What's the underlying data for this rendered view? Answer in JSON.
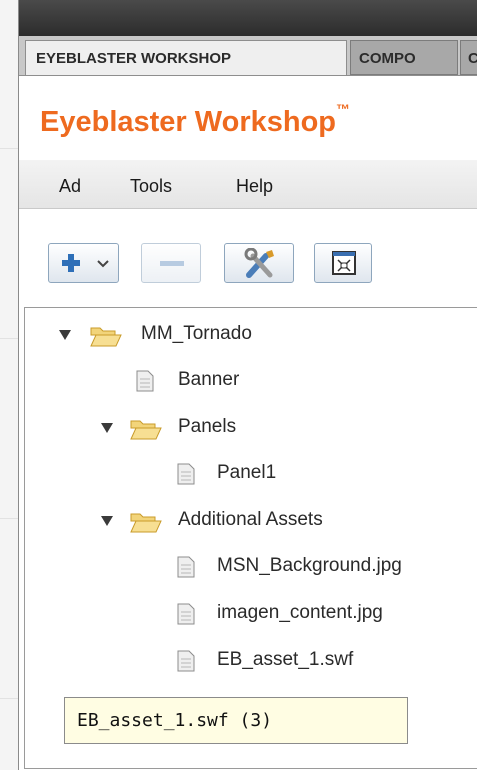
{
  "tabs": [
    {
      "label": "EYEBLASTER WORKSHOP",
      "active": true
    },
    {
      "label": "COMPO",
      "active": false
    },
    {
      "label": "CO",
      "active": false
    }
  ],
  "header": {
    "brand": "Eyeblaster Workshop",
    "trademark": "™",
    "brand_color": "#ee6a1f"
  },
  "menu": [
    "Ad",
    "Tools",
    "Help"
  ],
  "toolbar": {
    "buttons": [
      "add-icon",
      "remove-icon",
      "tools-icon",
      "fit-icon"
    ]
  },
  "tree": {
    "root": "MM_Tornado",
    "items": [
      "Banner",
      "Panels",
      "Panel1",
      "Additional Assets",
      "MSN_Background.jpg",
      "imagen_content.jpg",
      "EB_asset_1.swf"
    ]
  },
  "tooltip": "EB_asset_1.swf (3)"
}
